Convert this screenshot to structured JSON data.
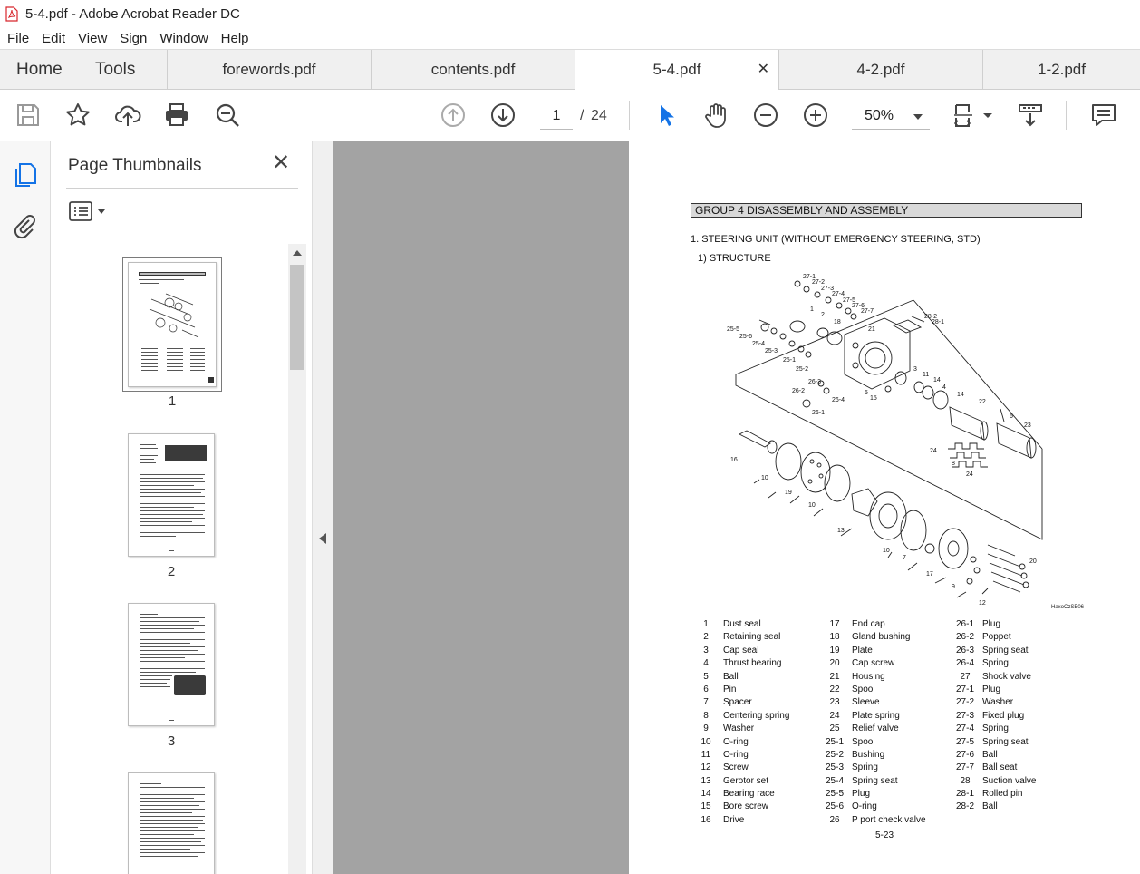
{
  "window": {
    "title": "5-4.pdf - Adobe Acrobat Reader DC"
  },
  "menu": [
    "File",
    "Edit",
    "View",
    "Sign",
    "Window",
    "Help"
  ],
  "tabs": {
    "home": "Home",
    "tools": "Tools",
    "documents": [
      "forewords.pdf",
      "contents.pdf",
      "5-4.pdf",
      "4-2.pdf",
      "1-2.pdf"
    ],
    "close_glyph": "✕"
  },
  "toolbar": {
    "current_page": "1",
    "page_separator": "/",
    "total_pages": "24",
    "zoom": "50%",
    "accent_color": "#1473e6"
  },
  "thumbnails_panel": {
    "title": "Page Thumbnails",
    "close_glyph": "✕",
    "labels": [
      "1",
      "2",
      "3"
    ]
  },
  "document": {
    "group_header": "GROUP  4  DISASSEMBLY AND ASSEMBLY",
    "section_title": "1. STEERING UNIT (WITHOUT EMERGENCY STEERING, STD)",
    "subsection_title": "1) STRUCTURE",
    "diagram_code": "HaxoCzSE06",
    "diagram_callouts": [
      "27-1",
      "27-2",
      "27-3",
      "27-4",
      "27-5",
      "27-6",
      "27-7",
      "28-2",
      "28-1",
      "25-5",
      "25-6",
      "25-4",
      "25-3",
      "25-1",
      "25-2",
      "1",
      "2",
      "18",
      "21",
      "3",
      "11",
      "14",
      "4",
      "14",
      "22",
      "6",
      "23",
      "24",
      "8",
      "24",
      "26-3",
      "26-2",
      "26-4",
      "26-1",
      "5",
      "15",
      "16",
      "10",
      "19",
      "10",
      "13",
      "10",
      "7",
      "17",
      "9",
      "20",
      "12"
    ],
    "parts": [
      [
        {
          "num": "1",
          "name": "Dust seal"
        },
        {
          "num": "2",
          "name": "Retaining seal"
        },
        {
          "num": "3",
          "name": "Cap seal"
        },
        {
          "num": "4",
          "name": "Thrust bearing"
        },
        {
          "num": "5",
          "name": "Ball"
        },
        {
          "num": "6",
          "name": "Pin"
        },
        {
          "num": "7",
          "name": "Spacer"
        },
        {
          "num": "8",
          "name": "Centering spring"
        },
        {
          "num": "9",
          "name": "Washer"
        },
        {
          "num": "10",
          "name": "O-ring"
        },
        {
          "num": "11",
          "name": "O-ring"
        },
        {
          "num": "12",
          "name": "Screw"
        },
        {
          "num": "13",
          "name": "Gerotor set"
        },
        {
          "num": "14",
          "name": "Bearing race"
        },
        {
          "num": "15",
          "name": "Bore screw"
        },
        {
          "num": "16",
          "name": "Drive"
        }
      ],
      [
        {
          "num": "17",
          "name": "End cap"
        },
        {
          "num": "18",
          "name": "Gland bushing"
        },
        {
          "num": "19",
          "name": "Plate"
        },
        {
          "num": "20",
          "name": "Cap screw"
        },
        {
          "num": "21",
          "name": "Housing"
        },
        {
          "num": "22",
          "name": "Spool"
        },
        {
          "num": "23",
          "name": "Sleeve"
        },
        {
          "num": "24",
          "name": "Plate spring"
        },
        {
          "num": "25",
          "name": "Relief valve"
        },
        {
          "num": "25-1",
          "name": "Spool"
        },
        {
          "num": "25-2",
          "name": "Bushing"
        },
        {
          "num": "25-3",
          "name": "Spring"
        },
        {
          "num": "25-4",
          "name": "Spring seat"
        },
        {
          "num": "25-5",
          "name": "Plug"
        },
        {
          "num": "25-6",
          "name": "O-ring"
        },
        {
          "num": "26",
          "name": "P port check valve"
        }
      ],
      [
        {
          "num": "26-1",
          "name": "Plug"
        },
        {
          "num": "26-2",
          "name": "Poppet"
        },
        {
          "num": "26-3",
          "name": "Spring seat"
        },
        {
          "num": "26-4",
          "name": "Spring"
        },
        {
          "num": "27",
          "name": "Shock valve"
        },
        {
          "num": "27-1",
          "name": "Plug"
        },
        {
          "num": "27-2",
          "name": "Washer"
        },
        {
          "num": "27-3",
          "name": "Fixed plug"
        },
        {
          "num": "27-4",
          "name": "Spring"
        },
        {
          "num": "27-5",
          "name": "Spring seat"
        },
        {
          "num": "27-6",
          "name": "Ball"
        },
        {
          "num": "27-7",
          "name": "Ball seat"
        },
        {
          "num": "28",
          "name": "Suction valve"
        },
        {
          "num": "28-1",
          "name": "Rolled pin"
        },
        {
          "num": "28-2",
          "name": "Ball"
        }
      ]
    ],
    "page_number": "5-23"
  }
}
